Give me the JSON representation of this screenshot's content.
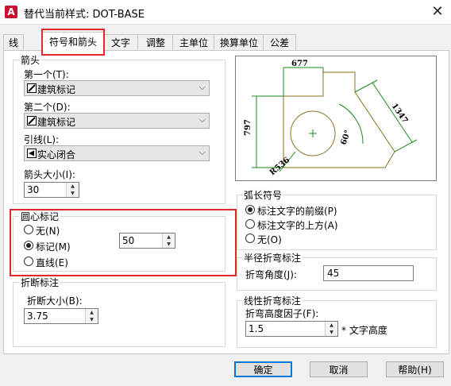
{
  "window": {
    "title": "替代当前样式: DOT-BASE",
    "app_icon_letter": "A"
  },
  "tabs": [
    {
      "label": "线"
    },
    {
      "label": "符号和箭头"
    },
    {
      "label": "文字"
    },
    {
      "label": "调整"
    },
    {
      "label": "主单位"
    },
    {
      "label": "换算单位"
    },
    {
      "label": "公差"
    }
  ],
  "active_tab": "符号和箭头",
  "arrowheads": {
    "group_label": "箭头",
    "first_label": "第一个(T):",
    "first_value": "建筑标记",
    "second_label": "第二个(D):",
    "second_value": "建筑标记",
    "leader_label": "引线(L):",
    "leader_value": "实心闭合",
    "size_label": "箭头大小(I):",
    "size_value": "30"
  },
  "center_marks": {
    "group_label": "圆心标记",
    "options": [
      {
        "label": "无(N)",
        "selected": false
      },
      {
        "label": "标记(M)",
        "selected": true
      },
      {
        "label": "直线(E)",
        "selected": false
      }
    ],
    "size_value": "50"
  },
  "break": {
    "group_label": "折断标注",
    "size_label": "折断大小(B):",
    "size_value": "3.75"
  },
  "preview": {
    "dims": {
      "top": "677",
      "left": "797",
      "diag": "1347",
      "angle": "60°",
      "radius": "R536"
    },
    "line_color": "#8a7020",
    "dim_color": "#1a8a1a"
  },
  "arc_length": {
    "group_label": "弧长符号",
    "options": [
      {
        "label": "标注文字的前缀(P)",
        "selected": true
      },
      {
        "label": "标注文字的上方(A)",
        "selected": false
      },
      {
        "label": "无(O)",
        "selected": false
      }
    ]
  },
  "radius_jog": {
    "group_label": "半径折弯标注",
    "angle_label": "折弯角度(J):",
    "angle_value": "45"
  },
  "linear_jog": {
    "group_label": "线性折弯标注",
    "factor_label": "折弯高度因子(F):",
    "factor_value": "1.5",
    "suffix": "* 文字高度"
  },
  "buttons": {
    "ok": "确定",
    "cancel": "取消",
    "help": "帮助(H)"
  }
}
